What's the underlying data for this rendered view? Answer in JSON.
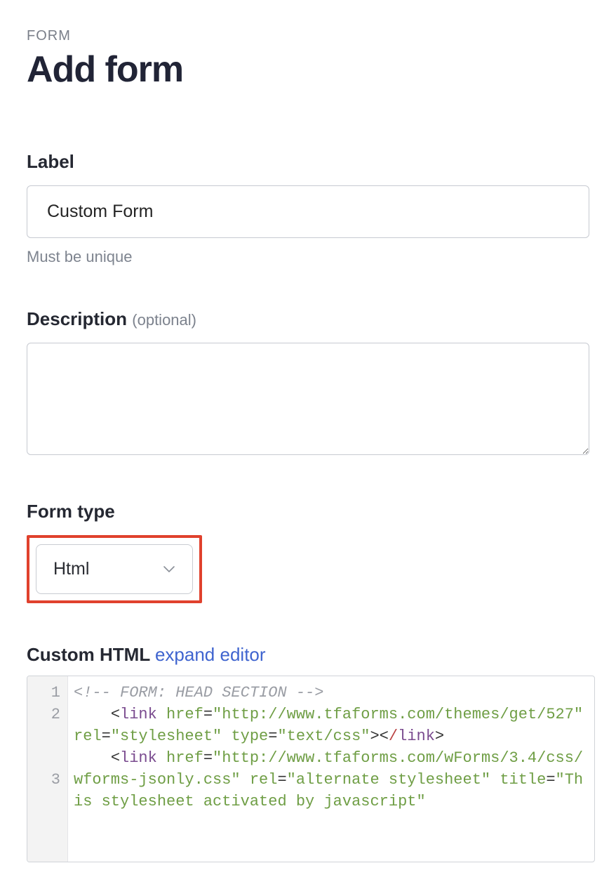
{
  "breadcrumb": "FORM",
  "page_title": "Add form",
  "fields": {
    "label": {
      "label": "Label",
      "value": "Custom Form",
      "hint": "Must be unique"
    },
    "description": {
      "label": "Description",
      "optional_text": "(optional)",
      "value": ""
    },
    "form_type": {
      "label": "Form type",
      "selected": "Html"
    },
    "custom_html": {
      "heading": "Custom HTML",
      "expand_label": "expand editor",
      "code": {
        "line1_comment": "<!-- FORM: HEAD SECTION -->",
        "link_tag": "link",
        "href_attr": "href",
        "rel_attr": "rel",
        "type_attr": "type",
        "title_attr": "title",
        "href1": "\"http://www.tfaforms.com/themes/get/527\"",
        "rel1": "\"stylesheet\"",
        "type1": "\"text/css\"",
        "href2": "\"http://www.tfaforms.com/wForms/3.4/css/wforms-jsonly.css\"",
        "rel2": "\"alternate stylesheet\"",
        "title2": "\"This stylesheet activated by javascript\""
      },
      "gutter": {
        "l1": "1",
        "l2": "2",
        "l3": "3"
      }
    }
  }
}
